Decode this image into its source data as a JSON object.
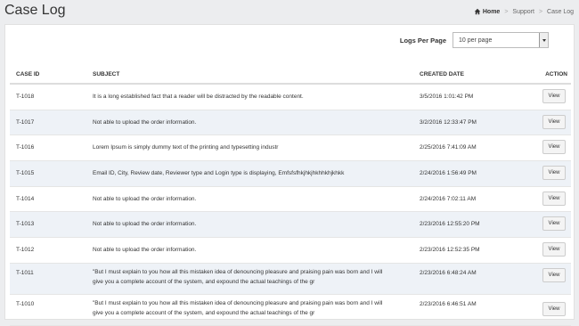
{
  "header": {
    "title": "Case Log",
    "breadcrumb": {
      "home": "Home",
      "support": "Support",
      "current": "Case Log"
    }
  },
  "controls": {
    "logs_per_page_label": "Logs Per Page",
    "logs_per_page_value": "10 per page"
  },
  "table": {
    "columns": {
      "id": "CASE ID",
      "subject": "SUBJECT",
      "date": "CREATED DATE",
      "action": "ACTION"
    },
    "view_label": "View",
    "rows": [
      {
        "id": "T-1018",
        "subject": " It is a long established fact that a reader will be distracted by the readable content.",
        "date": "3/5/2016 1:01:42 PM"
      },
      {
        "id": "T-1017",
        "subject": "Not able to upload the order information.",
        "date": "3/2/2016 12:33:47 PM"
      },
      {
        "id": "T-1016",
        "subject": " Lorem Ipsum is simply dummy text of the printing and typesetting industr",
        "date": "2/25/2016 7:41:09 AM"
      },
      {
        "id": "T-1015",
        "subject": "Email ID, City, Review date, Reviewer type and Login type is displaying, Emfsfsfhkjhkjhkhhkhjkhkk",
        "date": "2/24/2016 1:56:49 PM"
      },
      {
        "id": "T-1014",
        "subject": "Not able to upload the order information.",
        "date": "2/24/2016 7:02:11 AM"
      },
      {
        "id": "T-1013",
        "subject": "Not able to upload the order information.",
        "date": "2/23/2016 12:55:20 PM"
      },
      {
        "id": "T-1012",
        "subject": "Not able to upload the order information.",
        "date": "2/23/2016 12:52:35 PM"
      },
      {
        "id": "T-1011",
        "subject": " \"But I must explain to you how all this mistaken idea of denouncing pleasure and praising pain was born and I will give you a complete account of the system, and expound the actual teachings of the gr",
        "date": "2/23/2016 6:48:24 AM"
      },
      {
        "id": "T-1010",
        "subject": " \"But I must explain to you how all this mistaken idea of denouncing pleasure and praising pain was born and I will give you a complete account of the system, and expound the actual teachings of the gr",
        "date": "2/23/2016 6:46:51 AM"
      }
    ]
  }
}
